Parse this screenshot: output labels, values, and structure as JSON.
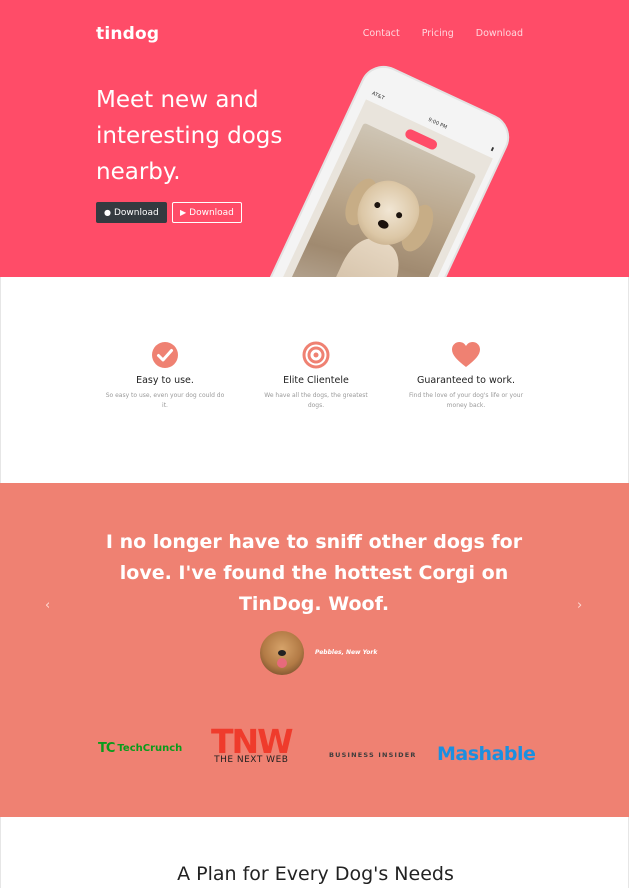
{
  "brand": "tindog",
  "nav": {
    "contact": "Contact",
    "pricing": "Pricing",
    "download": "Download"
  },
  "hero": {
    "headline": "Meet new and interesting dogs nearby.",
    "download_apple_label": "Download",
    "download_google_label": "Download"
  },
  "phone": {
    "carrier": "AT&T",
    "time": "9:00 PM"
  },
  "features": [
    {
      "icon": "check-circle-icon",
      "title": "Easy to use.",
      "text": "So easy to use, even your dog could do it."
    },
    {
      "icon": "bullseye-icon",
      "title": "Elite Clientele",
      "text": "We have all the dogs, the greatest dogs."
    },
    {
      "icon": "heart-icon",
      "title": "Guaranteed to work.",
      "text": "Find the love of your dog's life or your money back."
    }
  ],
  "testimonial": {
    "quote": "I no longer have to sniff other dogs for love. I've found the hottest Corgi on TinDog. Woof.",
    "author": "Pebbles, New York"
  },
  "press": {
    "techcrunch": "TechCrunch",
    "tc_mark": "TC",
    "tnw_big": "TNW",
    "tnw_small": "THE NEXT WEB",
    "business_insider": "BUSINESS INSIDER",
    "mashable": "Mashable"
  },
  "pricing": {
    "title": "A Plan for Every Dog's Needs"
  },
  "colors": {
    "brand_red": "#ff4c68",
    "salmon": "#ef8172",
    "icon_coral": "#ef8172",
    "dark_button": "#343a40"
  }
}
